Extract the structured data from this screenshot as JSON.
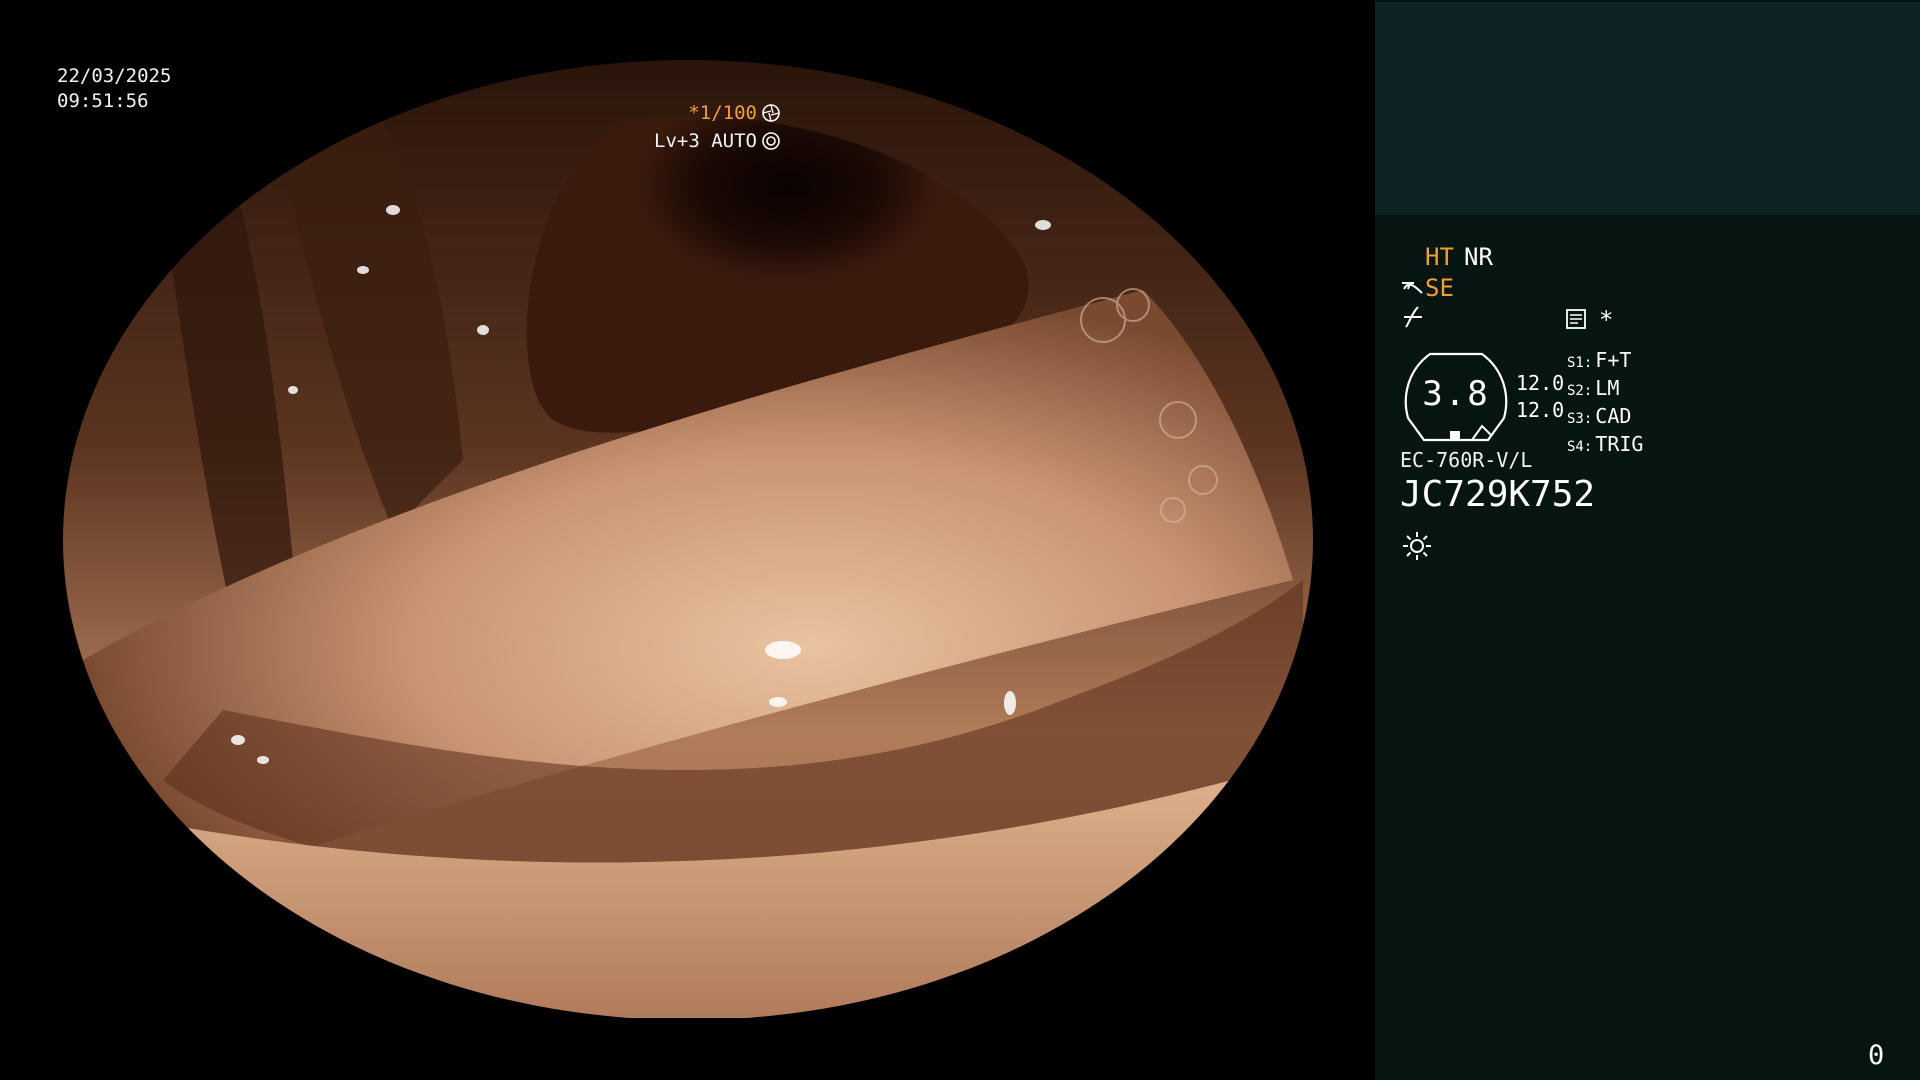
{
  "overlay": {
    "date": "22/03/2025",
    "time": "09:51:56",
    "shutter": "*1/100",
    "light_level": "Lv+3 AUTO"
  },
  "panel": {
    "ht_label": "HT",
    "nr_label": "NR",
    "se_label": "SE",
    "star_label": "*",
    "gauge_value": "3.8",
    "values": [
      "12.0",
      "12.0"
    ],
    "switches": [
      {
        "key": "S1:",
        "value": "F+T"
      },
      {
        "key": "S2:",
        "value": "LM"
      },
      {
        "key": "S3:",
        "value": "CAD"
      },
      {
        "key": "S4:",
        "value": "TRIG"
      }
    ],
    "scope_model": "EC-760R-V/L",
    "scope_serial": "JC729K752",
    "counter": "0"
  },
  "colors": {
    "accent_orange": "#f0a030",
    "panel_bg": "#061412",
    "panel_top_bg": "#0d2323",
    "text_white": "#ffffff"
  },
  "icons": {
    "shutter_icon": "aperture-icon",
    "auto_icon": "iris-icon",
    "se_icon": "scope-tip-icon",
    "curve_icon": "curve-icon",
    "memo_icon": "memo-icon",
    "light_icon": "sun-icon"
  }
}
